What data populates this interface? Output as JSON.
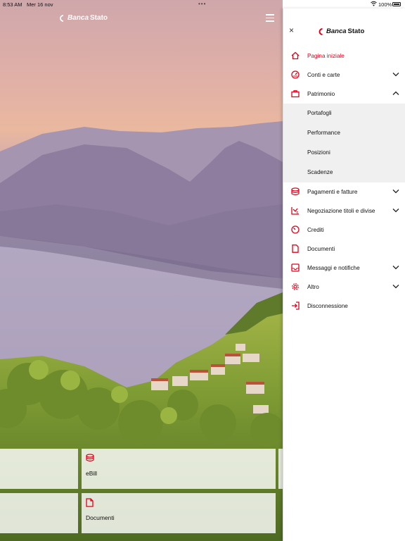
{
  "statusbar": {
    "time": "8:53 AM",
    "date": "Mer 16 nov",
    "dots": "•••",
    "battery": "100%"
  },
  "brand": {
    "name_left": "Banca",
    "name_right": "Stato",
    "accent": "#e2001a"
  },
  "tiles": [
    {
      "label": "eBill",
      "icon": "coins-icon"
    },
    {
      "label": "Documenti",
      "icon": "document-icon"
    }
  ],
  "menu": {
    "close_icon": "×",
    "items": [
      {
        "label": "Pagina iniziale",
        "icon": "home-icon",
        "active": true
      },
      {
        "label": "Conti e carte",
        "icon": "speedometer-icon",
        "expandable": true
      },
      {
        "label": "Patrimonio",
        "icon": "briefcase-icon",
        "expandable": true,
        "expanded": true,
        "children": [
          "Portafogli",
          "Performance",
          "Posizioni",
          "Scadenze"
        ]
      },
      {
        "label": "Pagamenti e fatture",
        "icon": "coins-icon",
        "expandable": true
      },
      {
        "label": "Negoziazione titoli e divise",
        "icon": "trading-icon",
        "expandable": true
      },
      {
        "label": "Crediti",
        "icon": "gauge-icon"
      },
      {
        "label": "Documenti",
        "icon": "document-icon"
      },
      {
        "label": "Messaggi e notifiche",
        "icon": "inbox-icon",
        "expandable": true
      },
      {
        "label": "Altro",
        "icon": "gear-icon",
        "expandable": true
      },
      {
        "label": "Disconnessione",
        "icon": "logout-icon"
      }
    ]
  }
}
